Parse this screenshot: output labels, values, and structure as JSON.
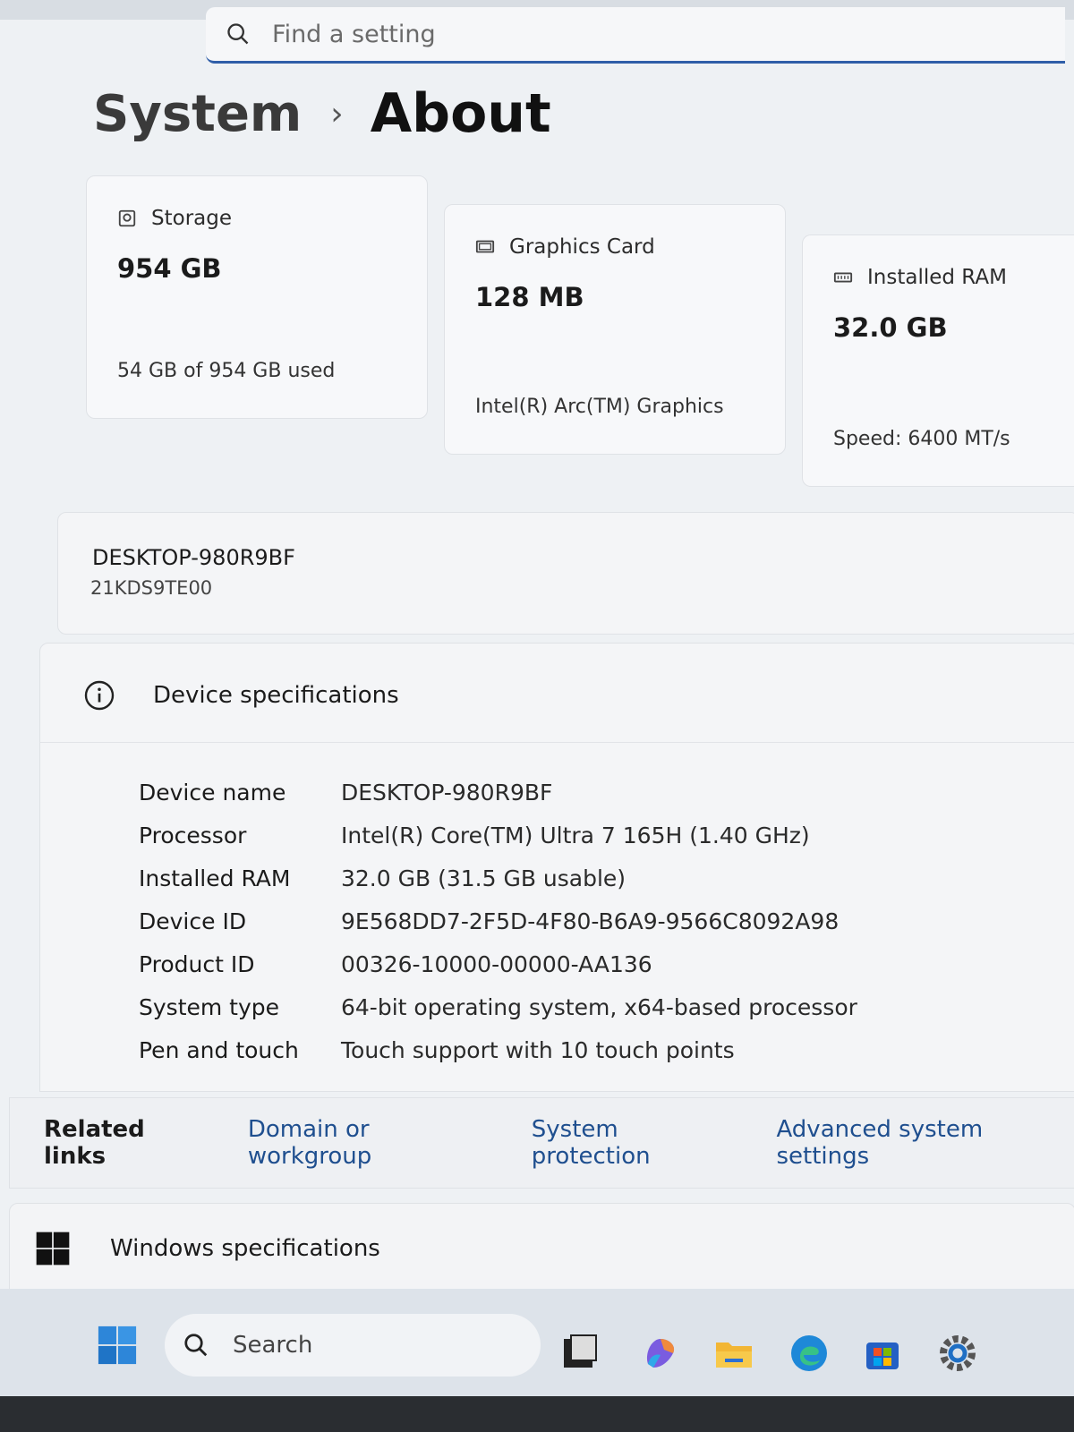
{
  "search": {
    "placeholder": "Find a setting"
  },
  "breadcrumb": {
    "parent": "System",
    "separator": "›",
    "current": "About"
  },
  "cards": {
    "storage": {
      "title": "Storage",
      "value": "954 GB",
      "detail": "54 GB of 954 GB used"
    },
    "graphics": {
      "title": "Graphics Card",
      "value": "128 MB",
      "detail": "Intel(R) Arc(TM) Graphics"
    },
    "ram": {
      "title": "Installed RAM",
      "value": "32.0 GB",
      "detail": "Speed: 6400 MT/s"
    }
  },
  "device": {
    "name": "DESKTOP-980R9BF",
    "model": "21KDS9TE00"
  },
  "specs": {
    "title": "Device specifications",
    "rows": [
      {
        "label": "Device name",
        "value": "DESKTOP-980R9BF"
      },
      {
        "label": "Processor",
        "value": "Intel(R) Core(TM) Ultra 7 165H (1.40 GHz)"
      },
      {
        "label": "Installed RAM",
        "value": "32.0 GB (31.5 GB usable)"
      },
      {
        "label": "Device ID",
        "value": "9E568DD7-2F5D-4F80-B6A9-9566C8092A98"
      },
      {
        "label": "Product ID",
        "value": "00326-10000-00000-AA136"
      },
      {
        "label": "System type",
        "value": "64-bit operating system, x64-based processor"
      },
      {
        "label": "Pen and touch",
        "value": "Touch support with 10 touch points"
      }
    ]
  },
  "related": {
    "label": "Related links",
    "links": [
      "Domain or workgroup",
      "System protection",
      "Advanced system settings"
    ]
  },
  "windows_spec": {
    "title": "Windows specifications"
  },
  "taskbar": {
    "search_label": "Search",
    "apps": [
      "task-view-icon",
      "copilot-icon",
      "file-explorer-icon",
      "edge-icon",
      "store-icon",
      "settings-icon"
    ]
  },
  "colors": {
    "accent": "#2f5ea8",
    "link": "#1f4f8f",
    "background": "#eef1f4"
  }
}
